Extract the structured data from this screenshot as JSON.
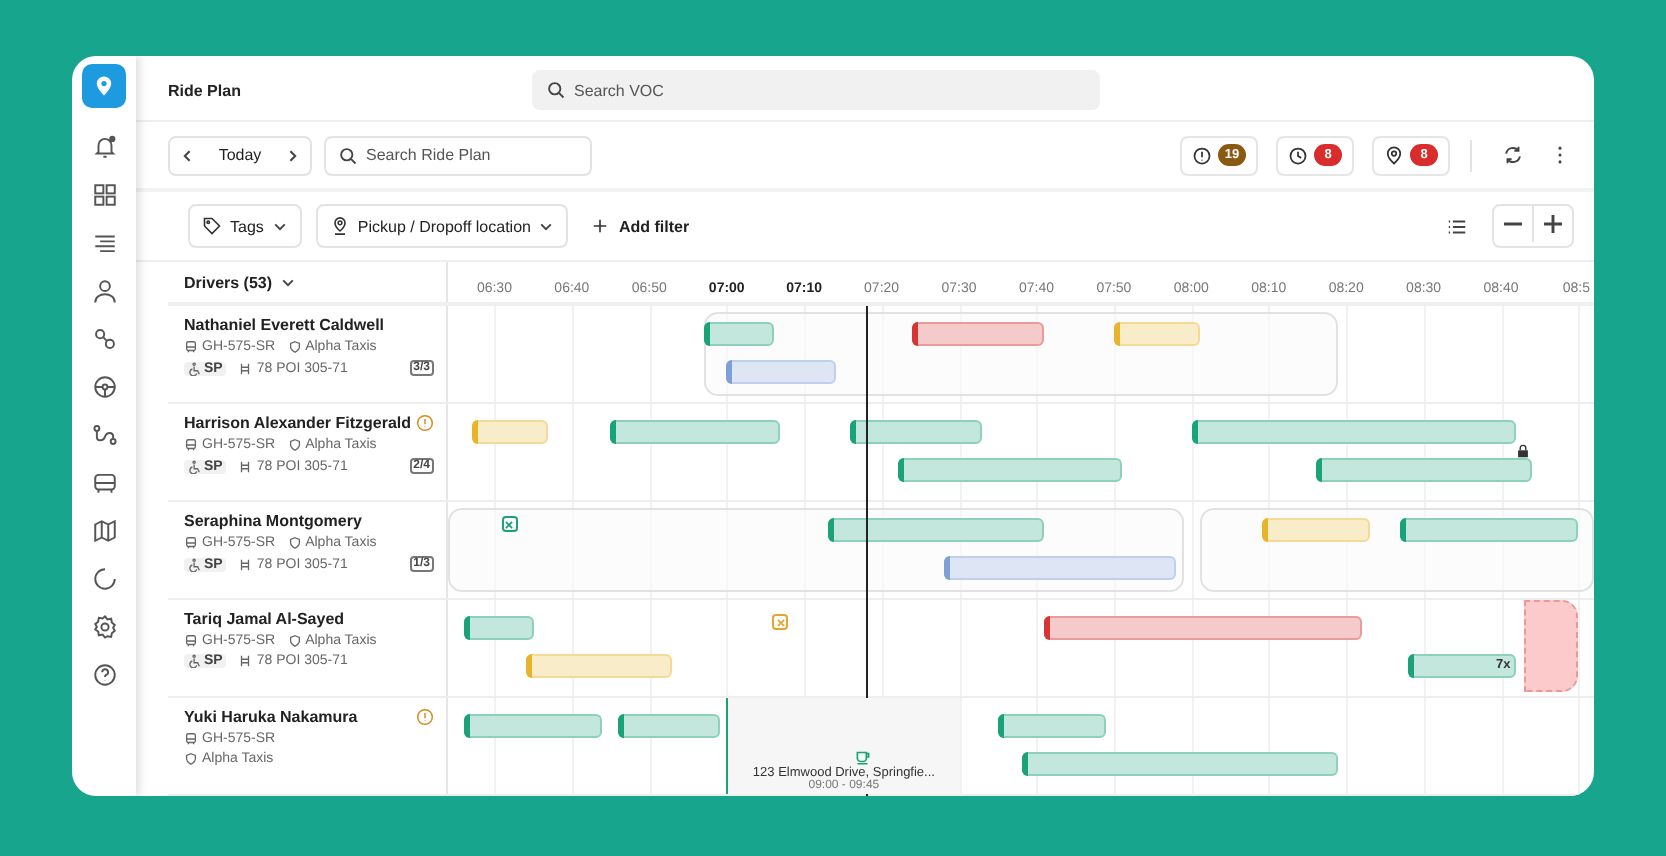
{
  "app": {
    "title": "Ride Plan"
  },
  "global_search": {
    "placeholder": "Search VOC"
  },
  "date_nav": {
    "label": "Today"
  },
  "ride_search": {
    "placeholder": "Search Ride Plan"
  },
  "alerts": [
    {
      "kind": "warning",
      "count": "19",
      "color": "#8a5a12"
    },
    {
      "kind": "clock",
      "count": "8",
      "color": "#d92d2d"
    },
    {
      "kind": "pin",
      "count": "8",
      "color": "#d92d2d"
    }
  ],
  "filters": [
    {
      "kind": "tags",
      "label": "Tags"
    },
    {
      "kind": "location",
      "label": "Pickup / Dropoff location"
    }
  ],
  "add_filter": {
    "label": "Add filter"
  },
  "drivers_header": {
    "label": "Drivers (53)"
  },
  "timeline": {
    "ticks": [
      {
        "label": "06:30",
        "emphasis": false
      },
      {
        "label": "06:40",
        "emphasis": false
      },
      {
        "label": "06:50",
        "emphasis": false
      },
      {
        "label": "07:00",
        "emphasis": true
      },
      {
        "label": "07:10",
        "emphasis": true
      },
      {
        "label": "07:20",
        "emphasis": false
      },
      {
        "label": "07:30",
        "emphasis": false
      },
      {
        "label": "07:40",
        "emphasis": false
      },
      {
        "label": "07:50",
        "emphasis": false
      },
      {
        "label": "08:00",
        "emphasis": false
      },
      {
        "label": "08:10",
        "emphasis": false
      },
      {
        "label": "08:20",
        "emphasis": false
      },
      {
        "label": "08:30",
        "emphasis": false
      },
      {
        "label": "08:40",
        "emphasis": false
      },
      {
        "label": "08:5",
        "emphasis": false
      }
    ]
  },
  "drivers": [
    {
      "name": "Nathaniel Everett Caldwell",
      "warning": false,
      "vehicle": "GH-575-SR",
      "company": "Alpha Taxis",
      "accessibility": "SP",
      "route": "78 POI 305-71",
      "capacity": "3/3",
      "lanes": [
        [
          {
            "color": "#1aa279",
            "locked": false
          },
          {
            "color": "#d73434",
            "locked": false
          },
          {
            "color": "#e8b42c",
            "locked": false
          }
        ],
        [
          {
            "color": "#7f9fd8",
            "locked": false
          }
        ]
      ]
    },
    {
      "name": "Harrison Alexander Fitzgerald",
      "warning": true,
      "vehicle": "GH-575-SR",
      "company": "Alpha Taxis",
      "accessibility": "SP",
      "route": "78 POI 305-71",
      "capacity": "2/4",
      "lanes": [
        [
          {
            "color": "#e8b42c",
            "locked": false
          },
          {
            "color": "#1aa279",
            "locked": false
          },
          {
            "color": "#1aa279",
            "locked": false
          },
          {
            "color": "#1aa279",
            "locked": false
          }
        ],
        [
          {
            "color": "#1aa279",
            "locked": false
          },
          {
            "color": "#1aa279",
            "locked": true
          }
        ]
      ]
    },
    {
      "name": "Seraphina Montgomery",
      "warning": false,
      "vehicle": "GH-575-SR",
      "company": "Alpha Taxis",
      "accessibility": "SP",
      "route": "78 POI 305-71",
      "capacity": "1/3",
      "markers": [
        {
          "color": "#1ba27a"
        }
      ],
      "lanes": [
        [
          {
            "color": "#1aa279",
            "locked": false
          },
          {
            "color": "#e8b42c",
            "locked": false
          },
          {
            "color": "#1aa279",
            "locked": false
          }
        ],
        [
          {
            "color": "#7f9fd8",
            "locked": false
          }
        ]
      ]
    },
    {
      "name": "Tariq Jamal Al-Sayed",
      "warning": false,
      "vehicle": "GH-575-SR",
      "company": "Alpha Taxis",
      "accessibility": "SP",
      "route": "78 POI 305-71",
      "markers": [
        {
          "color": "#e0a82e"
        }
      ],
      "blocks": [
        {
          "kind": "pending"
        }
      ],
      "lanes": [
        [
          {
            "color": "#1aa279",
            "locked": false
          },
          {
            "color": "#d73434",
            "locked": false
          }
        ],
        [
          {
            "color": "#e8b42c",
            "locked": false
          },
          {
            "color": "#1aa279",
            "locked": false,
            "label": "7x"
          }
        ]
      ]
    },
    {
      "name": "Yuki Haruka Nakamura",
      "warning": true,
      "vehicle": "GH-575-SR",
      "company": "Alpha Taxis",
      "blocks": [
        {
          "kind": "break",
          "address": "123 Elmwood Drive, Springfie...",
          "time": "09:00 - 09:45"
        }
      ],
      "lanes": [
        [
          {
            "color": "#1aa279",
            "locked": false
          },
          {
            "color": "#1aa279",
            "locked": false
          },
          {
            "color": "#1aa279",
            "locked": false
          }
        ],
        [
          {
            "color": "#1aa279",
            "locked": false
          }
        ]
      ]
    }
  ]
}
